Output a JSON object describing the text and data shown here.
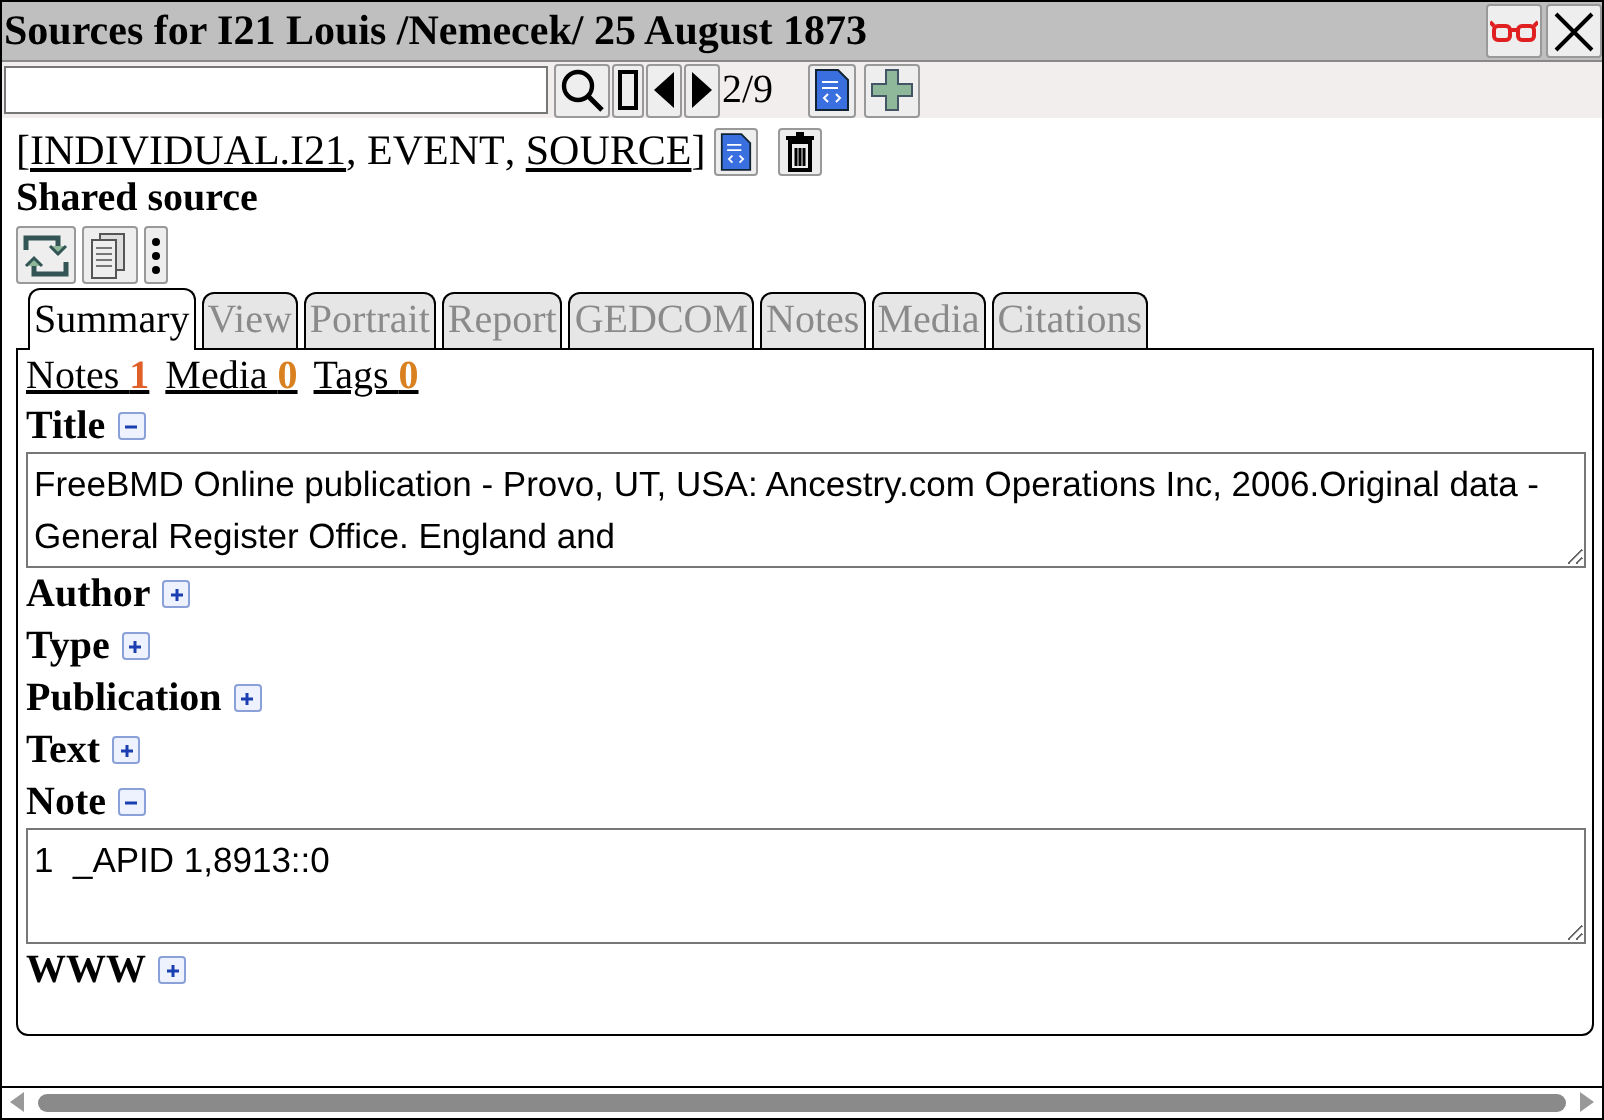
{
  "window": {
    "title": "Sources for I21 Louis /Nemecek/ 25 August 1873"
  },
  "toolbar": {
    "counter": "2/9"
  },
  "breadcrumb": [
    {
      "before": "[",
      "text": "INDIVIDUAL.I21",
      "link": true
    },
    {
      "before": ", ",
      "text": "EVENT",
      "link": false
    },
    {
      "before": ", ",
      "text": "SOURCE",
      "link": true,
      "after": "]"
    }
  ],
  "heading": "Shared source",
  "tabs": [
    {
      "label": "Summary",
      "selected": true,
      "disabled": false
    },
    {
      "label": "View",
      "selected": false,
      "disabled": true
    },
    {
      "label": "Portrait",
      "selected": false,
      "disabled": true
    },
    {
      "label": "Report",
      "selected": false,
      "disabled": true
    },
    {
      "label": "GEDCOM",
      "selected": false,
      "disabled": true
    },
    {
      "label": "Notes",
      "selected": false,
      "disabled": true
    },
    {
      "label": "Media",
      "selected": false,
      "disabled": true
    },
    {
      "label": "Citations",
      "selected": false,
      "disabled": true
    }
  ],
  "counts": [
    {
      "label": "Notes",
      "count": "1",
      "color": "#e0602a"
    },
    {
      "label": "Media",
      "count": "0",
      "color": "#d98020"
    },
    {
      "label": "Tags",
      "count": "0",
      "color": "#d98020"
    }
  ],
  "sections": [
    {
      "label": "Title",
      "expanded": true,
      "value": "FreeBMD Online publication - Provo, UT, USA: Ancestry.com Operations Inc, 2006.Original data - General Register Office. England and"
    },
    {
      "label": "Author",
      "expanded": false
    },
    {
      "label": "Type",
      "expanded": false
    },
    {
      "label": "Publication",
      "expanded": false
    },
    {
      "label": "Text",
      "expanded": false
    },
    {
      "label": "Note",
      "expanded": true,
      "value": "1  _APID 1,8913::0"
    },
    {
      "label": "WWW",
      "expanded": false
    }
  ]
}
